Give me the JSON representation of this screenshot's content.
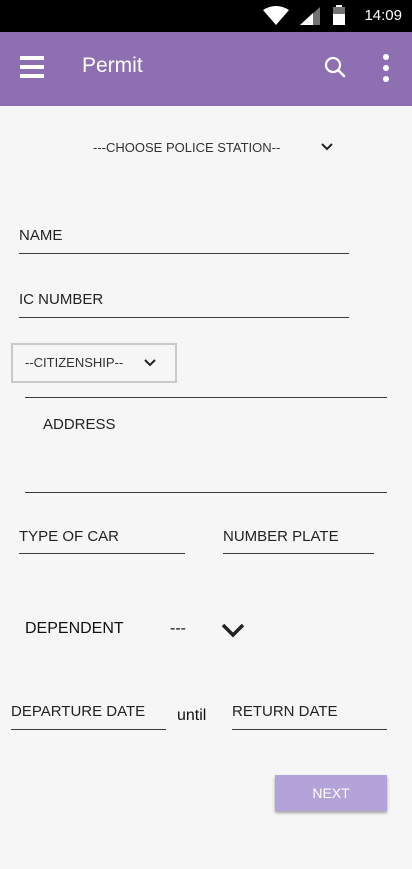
{
  "status_bar": {
    "time": "14:09"
  },
  "app_bar": {
    "title": "Permit"
  },
  "police_station": {
    "selected": "---CHOOSE POLICE STATION--"
  },
  "fields": {
    "name": "NAME",
    "ic_number": "IC NUMBER",
    "address": "ADDRESS",
    "type_of_car": "TYPE OF CAR",
    "number_plate": "NUMBER PLATE",
    "departure_date": "DEPARTURE DATE",
    "return_date": "RETURN DATE"
  },
  "citizenship": {
    "selected": "--CITIZENSHIP--"
  },
  "dependent": {
    "label": "DEPENDENT",
    "selected": "---"
  },
  "until_label": "until",
  "next_button": "NEXT",
  "colors": {
    "app_bar": "#8e6fb2",
    "next_button": "#b4a3d8"
  }
}
